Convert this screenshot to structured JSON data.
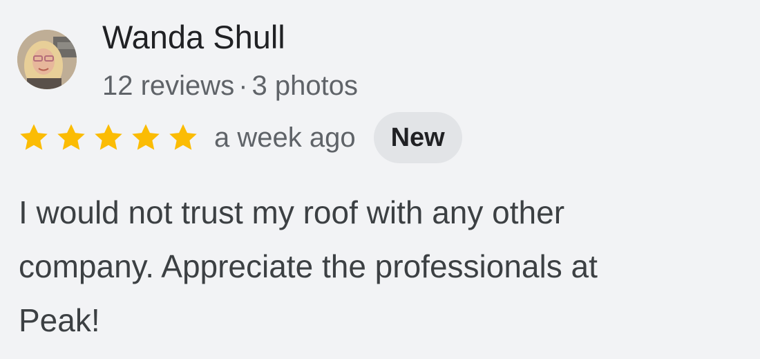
{
  "reviewer": {
    "name": "Wanda Shull",
    "reviews_count": "12 reviews",
    "separator": "·",
    "photos_count": "3 photos"
  },
  "rating": {
    "stars": 5,
    "max_stars": 5,
    "star_color": "#fbbc04",
    "date": "a week ago",
    "badge": "New"
  },
  "review": {
    "lines": [
      "I would not trust my roof with any other",
      "company. Appreciate the professionals at",
      "Peak!"
    ]
  }
}
